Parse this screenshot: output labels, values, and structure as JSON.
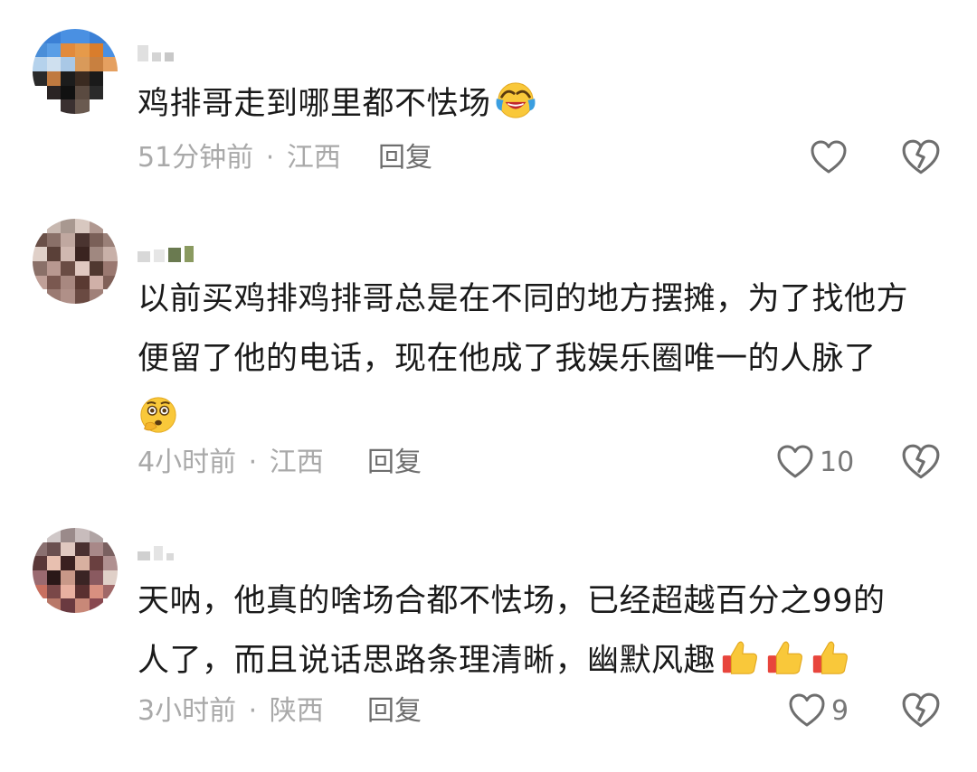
{
  "comments": [
    {
      "text": "鸡排哥走到哪里都不怯场",
      "emoji": "laughing-crying-emoji",
      "time": "51分钟前",
      "location": "江西",
      "reply_label": "回复",
      "like_count": ""
    },
    {
      "text_line1": "以前买鸡排鸡排哥总是在不同的地方摆摊，为了找他方",
      "text_line2": "便留了他的电话，现在他成了我娱乐圈唯一的人脉了",
      "emoji": "shushing-wow-emoji",
      "time": "4小时前",
      "location": "江西",
      "reply_label": "回复",
      "like_count": "10"
    },
    {
      "text_line1": "天呐，他真的啥场合都不怯场，已经超越百分之99的",
      "text_line2": "人了，而且说话思路条理清晰，幽默风趣",
      "emoji": "thumbs-up-emoji",
      "time": "3小时前",
      "location": "陕西",
      "reply_label": "回复",
      "like_count": "9"
    }
  ],
  "meta_separator": "·",
  "colors": {
    "text": "#1a1a1a",
    "meta": "#a9a9a9",
    "reply": "#6e6e6e",
    "icon": "#6e6e6e"
  }
}
